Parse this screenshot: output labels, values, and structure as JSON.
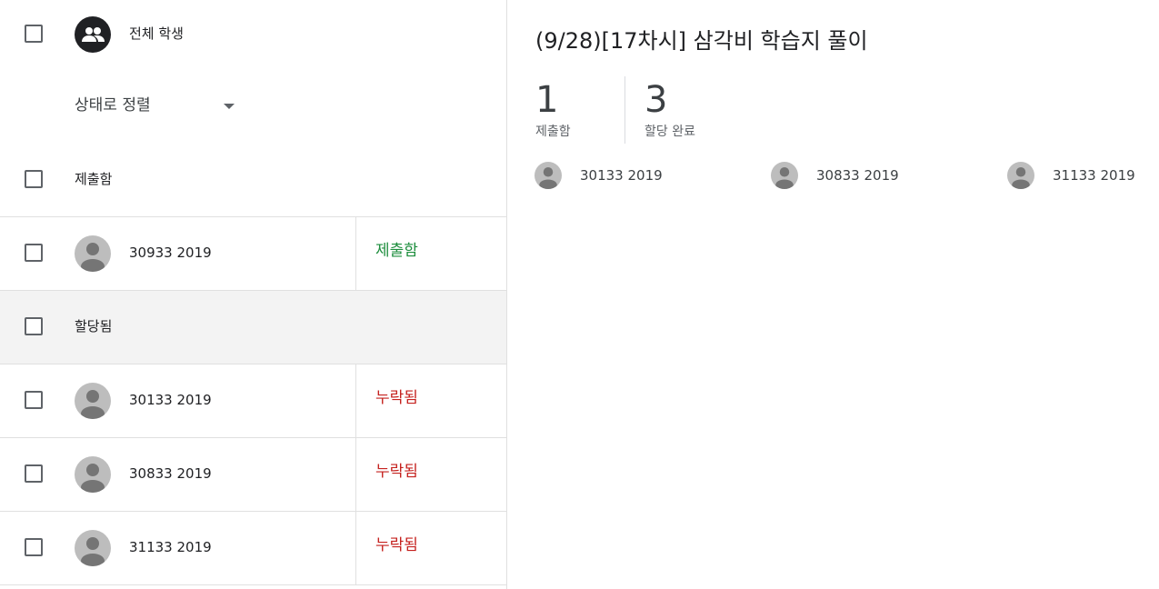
{
  "left": {
    "all_students_label": "전체 학생",
    "sort_label": "상태로 정렬",
    "sections": {
      "submitted_label": "제출함",
      "assigned_label": "할당됨"
    },
    "submitted_rows": [
      {
        "name": "30933 2019",
        "status": "제출함"
      }
    ],
    "assigned_rows": [
      {
        "name": "30133 2019",
        "status": "누락됨"
      },
      {
        "name": "30833 2019",
        "status": "누락됨"
      },
      {
        "name": "31133 2019",
        "status": "누락됨"
      }
    ]
  },
  "right": {
    "title": "(9/28)[17차시] 삼각비 학습지 풀이",
    "stats": [
      {
        "value": "1",
        "label": "제출함"
      },
      {
        "value": "3",
        "label": "할당 완료"
      }
    ],
    "students": [
      "30133 2019",
      "30833 2019",
      "31133 2019"
    ]
  },
  "colors": {
    "submitted": "#1e8e3e",
    "missing": "#c5221f",
    "avatar_bg": "#bdbdbd",
    "avatar_fg": "#757575",
    "group_icon_bg": "#202124"
  }
}
